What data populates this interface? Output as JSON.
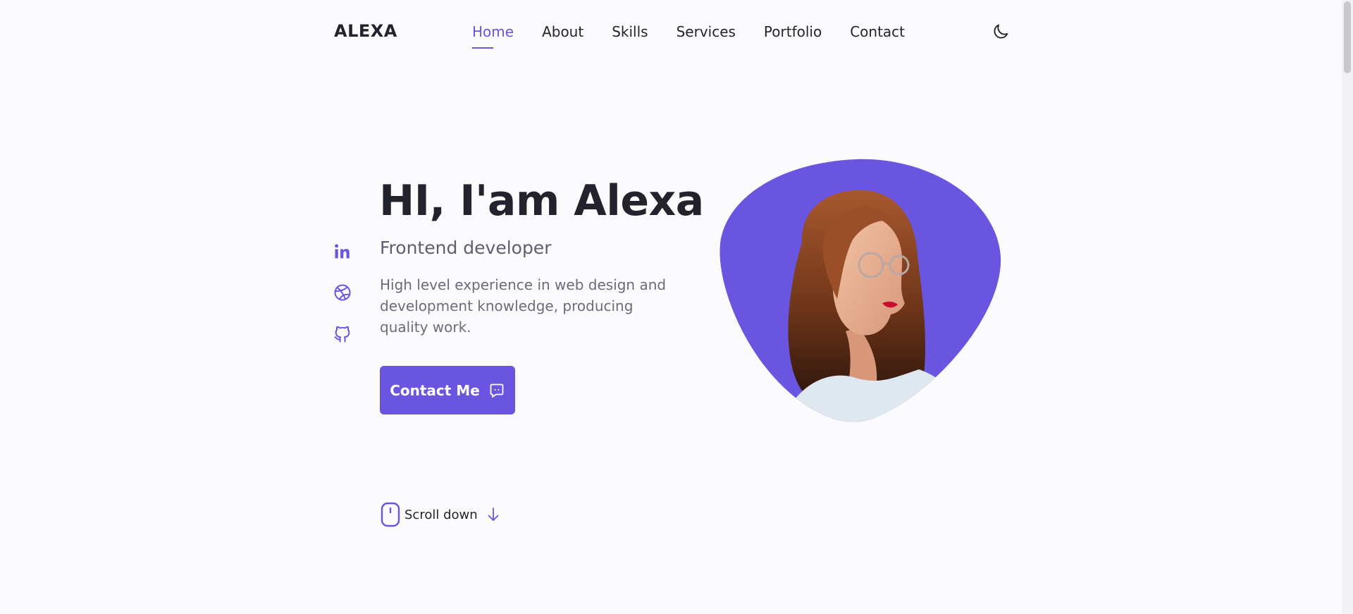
{
  "header": {
    "brand": "ALEXA",
    "nav": [
      {
        "label": "Home",
        "active": true
      },
      {
        "label": "About"
      },
      {
        "label": "Skills"
      },
      {
        "label": "Services"
      },
      {
        "label": "Portfolio"
      },
      {
        "label": "Contact"
      }
    ],
    "theme_toggle_icon": "moon-icon"
  },
  "social": [
    {
      "icon": "linkedin-icon"
    },
    {
      "icon": "dribbble-icon"
    },
    {
      "icon": "github-icon"
    }
  ],
  "hero": {
    "title": "HI, I'am Alexa",
    "subtitle": "Frontend developer",
    "description": "High level experience in web design and development knowledge, producing quality work.",
    "cta_label": "Contact Me",
    "cta_icon": "chat-icon"
  },
  "scroll": {
    "label": "Scroll down",
    "mouse_icon": "mouse-icon",
    "arrow_icon": "arrow-down-icon"
  },
  "colors": {
    "accent": "#6a55e0",
    "background": "#fbfbfd",
    "text": "#23232e",
    "muted_text": "#6b6b7b"
  }
}
